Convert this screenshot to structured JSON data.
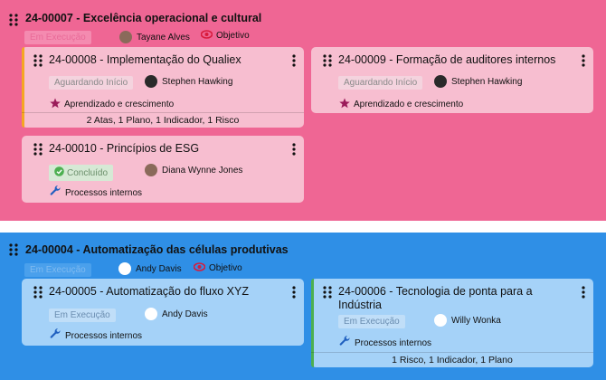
{
  "groups": [
    {
      "title": "24-00007 - Excelência operacional e cultural",
      "status": "Em Execução",
      "owner": "Tayane Alves",
      "tag": "Objetivo",
      "cards": [
        {
          "title": "24-00008 - Implementação do Qualiex",
          "status": "Aguardando Início",
          "owner": "Stephen Hawking",
          "category": "Aprendizado e crescimento",
          "summary": "2 Atas, 1 Plano, 1 Indicador, 1 Risco"
        },
        {
          "title": "24-00009 - Formação de auditores internos",
          "status": "Aguardando Início",
          "owner": "Stephen Hawking",
          "category": "Aprendizado e crescimento"
        },
        {
          "title": "24-00010 - Princípios de ESG",
          "status": "Concluído",
          "owner": "Diana Wynne Jones",
          "category": "Processos internos"
        }
      ]
    },
    {
      "title": "24-00004 - Automatização das células produtivas",
      "status": "Em Execução",
      "owner": "Andy Davis",
      "tag": "Objetivo",
      "cards": [
        {
          "title": "24-00005 - Automatização do fluxo XYZ",
          "status": "Em Execução",
          "owner": "Andy Davis",
          "category": "Processos internos"
        },
        {
          "title": "24-00006 - Tecnologia de ponta para a Indústria",
          "status": "Em Execução",
          "owner": "Willy Wonka",
          "category": "Processos internos",
          "summary": "1 Risco, 1 Indicador, 1 Plano"
        }
      ]
    }
  ],
  "colors": {
    "pink_section": "#ef6694",
    "blue_section": "#2f8fe6",
    "accent_orange": "#f5a623",
    "accent_green": "#4caf50",
    "star": "#9b1b5a",
    "wrench": "#1f5fbf",
    "eye": "#d81b3c"
  },
  "icons": {
    "drag": "drag-handle-icon",
    "menu": "kebab-menu-icon",
    "eye": "eye-icon",
    "star": "star-icon",
    "wrench": "wrench-icon",
    "check": "check-circle-icon"
  }
}
